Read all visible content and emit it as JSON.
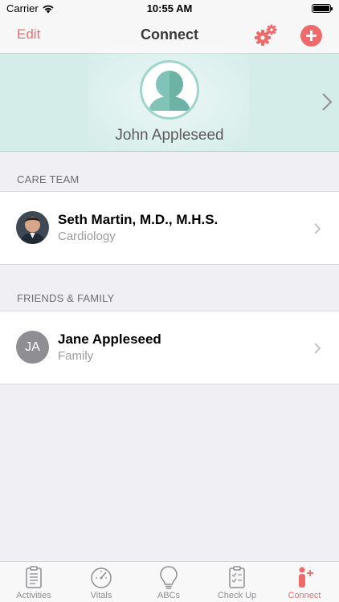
{
  "status_bar": {
    "carrier": "Carrier",
    "time": "10:55 AM"
  },
  "nav": {
    "edit_label": "Edit",
    "title": "Connect",
    "settings_icon": "gears-icon",
    "add_icon": "plus-circle-icon"
  },
  "profile": {
    "name": "John Appleseed"
  },
  "care_team": {
    "header": "CARE TEAM",
    "items": [
      {
        "name": "Seth Martin, M.D., M.H.S.",
        "subtitle": "Cardiology",
        "avatar": "photo"
      }
    ]
  },
  "friends_family": {
    "header": "FRIENDS & FAMILY",
    "items": [
      {
        "name": "Jane Appleseed",
        "subtitle": "Family",
        "initials": "JA"
      }
    ]
  },
  "tabs": [
    {
      "label": "Activities",
      "icon": "clipboard-icon",
      "active": false
    },
    {
      "label": "Vitals",
      "icon": "gauge-icon",
      "active": false
    },
    {
      "label": "ABCs",
      "icon": "lightbulb-icon",
      "active": false
    },
    {
      "label": "Check Up",
      "icon": "checklist-icon",
      "active": false
    },
    {
      "label": "Connect",
      "icon": "person-plus-icon",
      "active": true
    }
  ],
  "colors": {
    "accent": "#ef6b6b",
    "profile_bg": "#d4ede9",
    "avatar_teal": "#7fc4b6"
  }
}
